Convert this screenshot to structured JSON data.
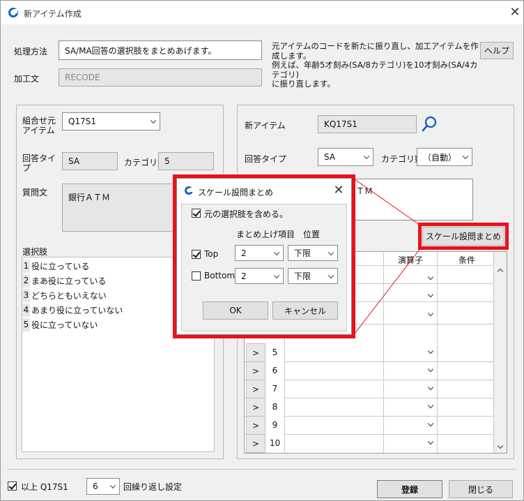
{
  "window": {
    "title": "新アイテム作成",
    "close_label": "✕"
  },
  "top": {
    "method_label": "処理方法",
    "method_value": "SA/MA回答の選択肢をまとめあげます。",
    "process_label": "加工文",
    "process_placeholder": "RECODE",
    "info_lines": [
      "元アイテムのコードを新たに振り直し、加工アイテムを作成します。",
      "例えば、年齢5才刻み(SA/8カテゴリ)を10才刻み(SA/4カテゴリ)",
      "に振り直します。"
    ],
    "help_label": "ヘルプ"
  },
  "left": {
    "source_label_1": "組合せ元",
    "source_label_2": "アイテム",
    "source_value": "Q17S1",
    "answer_type_label_1": "回答タイ",
    "answer_type_label_2": "プ",
    "answer_type_value": "SA",
    "category_count_label": "カテゴリ数",
    "category_count_value": "5",
    "question_label": "質問文",
    "question_value": "銀行ＡＴＭ",
    "choices_label": "選択肢",
    "choices": [
      {
        "num": "1",
        "text": "役に立っている"
      },
      {
        "num": "2",
        "text": "まあ役に立っている"
      },
      {
        "num": "3",
        "text": "どちらともいえない"
      },
      {
        "num": "4",
        "text": "あまり役に立っていない"
      },
      {
        "num": "5",
        "text": "役に立っていない"
      }
    ]
  },
  "right": {
    "new_item_label": "新アイテム",
    "new_item_value": "KQ17S1",
    "answer_type_label": "回答タイプ",
    "answer_type_value": "SA",
    "category_count_label": "カテゴリ数",
    "category_count_value": "（自動）",
    "question_partial": "ＴＭ",
    "scale_button_label": "スケール設問まとめ",
    "grid": {
      "col_operator": "演算子",
      "col_condition": "条件",
      "row_button": ">",
      "rows": [
        "5",
        "6",
        "7",
        "8",
        "9",
        "10"
      ]
    }
  },
  "bottom": {
    "repeat_check_label": "以上 Q17S1",
    "repeat_count": "6",
    "repeat_label": "回繰り返し設定",
    "register_label": "登録",
    "close_label": "閉じる"
  },
  "dialog": {
    "title": "スケール設問まとめ",
    "close_label": "✕",
    "include_label": "元の選択肢を含める。",
    "col_items": "まとめ上げ項目",
    "col_position": "位置",
    "top_label": "Top",
    "top_count": "2",
    "top_position": "下限",
    "bottom_label": "Bottom",
    "bottom_count": "2",
    "bottom_position": "下限",
    "ok_label": "OK",
    "cancel_label": "キャンセル"
  },
  "colors": {
    "highlight": "#e8121b",
    "accent": "#1565c0"
  }
}
